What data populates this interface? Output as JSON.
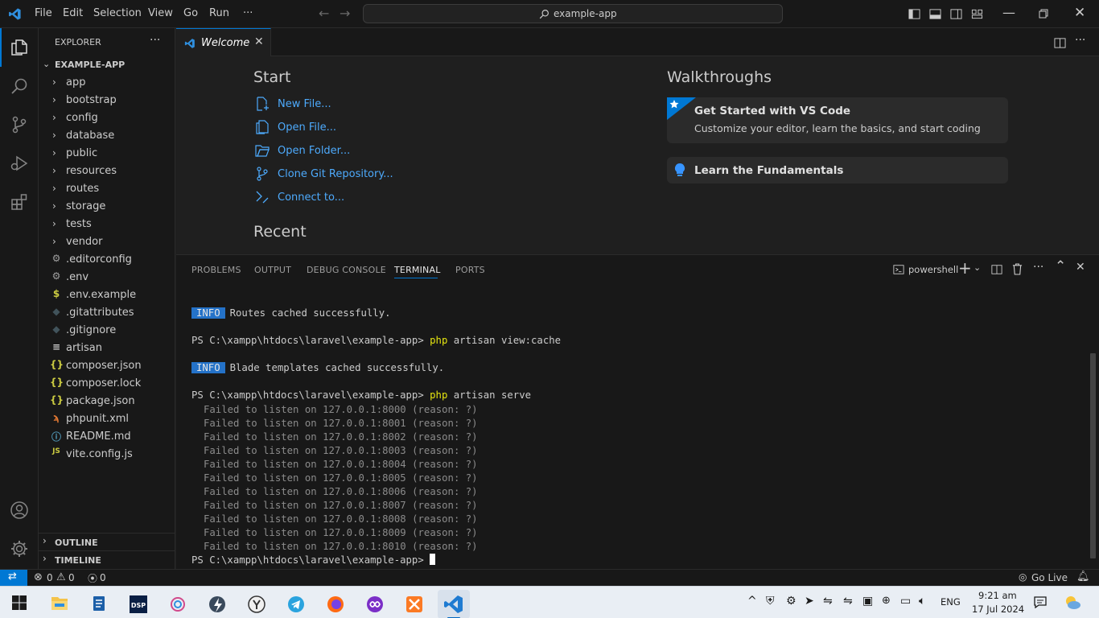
{
  "titlebar": {
    "menu": [
      "File",
      "Edit",
      "Selection",
      "View",
      "Go",
      "Run",
      "···"
    ],
    "search": "example-app"
  },
  "sidebar": {
    "title": "EXPLORER",
    "more": "···",
    "project": "EXAMPLE-APP",
    "folders": [
      "app",
      "bootstrap",
      "config",
      "database",
      "public",
      "resources",
      "routes",
      "storage",
      "tests",
      "vendor"
    ],
    "files": [
      {
        "name": ".editorconfig",
        "icon": "gear-icon",
        "glyph": "⚙",
        "color": "#a0a0a0"
      },
      {
        "name": ".env",
        "icon": "gear-icon",
        "glyph": "⚙",
        "color": "#a0a0a0"
      },
      {
        "name": ".env.example",
        "icon": "dollar-icon",
        "glyph": "$",
        "color": "#cbcb41"
      },
      {
        "name": ".gitattributes",
        "icon": "git-diamond-icon",
        "glyph": "◆",
        "color": "#41535b"
      },
      {
        "name": ".gitignore",
        "icon": "git-diamond-icon",
        "glyph": "◆",
        "color": "#41535b"
      },
      {
        "name": "artisan",
        "icon": "lines-icon",
        "glyph": "≡",
        "color": "#cccccc"
      },
      {
        "name": "composer.json",
        "icon": "braces-icon",
        "glyph": "{}",
        "color": "#cbcb41"
      },
      {
        "name": "composer.lock",
        "icon": "braces-icon",
        "glyph": "{}",
        "color": "#cbcb41"
      },
      {
        "name": "package.json",
        "icon": "braces-icon",
        "glyph": "{}",
        "color": "#cbcb41"
      },
      {
        "name": "phpunit.xml",
        "icon": "rss-icon",
        "glyph": "ϡ",
        "color": "#e37933"
      },
      {
        "name": "README.md",
        "icon": "info-icon",
        "glyph": "ⓘ",
        "color": "#519aba"
      },
      {
        "name": "vite.config.js",
        "icon": "js-icon",
        "glyph": "JS",
        "color": "#cbcb41"
      }
    ],
    "outline": "OUTLINE",
    "timeline": "TIMELINE"
  },
  "editor": {
    "tab": "Welcome",
    "start": {
      "heading": "Start",
      "links": [
        "New File...",
        "Open File...",
        "Open Folder...",
        "Clone Git Repository...",
        "Connect to..."
      ]
    },
    "recent": {
      "heading": "Recent"
    },
    "walkthroughs": {
      "heading": "Walkthroughs",
      "card1_title": "Get Started with VS Code",
      "card1_desc": "Customize your editor, learn the basics, and start coding",
      "card2_title": "Learn the Fundamentals"
    }
  },
  "panel": {
    "tabs": [
      "PROBLEMS",
      "OUTPUT",
      "DEBUG CONSOLE",
      "TERMINAL",
      "PORTS"
    ],
    "active_tab": "TERMINAL",
    "shell": "powershell",
    "terminal": {
      "info_label": "INFO",
      "routes_msg": "Routes cached successfully.",
      "prompt": "PS C:\\xampp\\htdocs\\laravel\\example-app>",
      "php": "php",
      "cmd_view": "artisan view:cache",
      "blade_msg": "Blade templates cached successfully.",
      "cmd_serve": "artisan serve",
      "failed": [
        "Failed to listen on 127.0.0.1:8000 (reason: ?)",
        "Failed to listen on 127.0.0.1:8001 (reason: ?)",
        "Failed to listen on 127.0.0.1:8002 (reason: ?)",
        "Failed to listen on 127.0.0.1:8003 (reason: ?)",
        "Failed to listen on 127.0.0.1:8004 (reason: ?)",
        "Failed to listen on 127.0.0.1:8005 (reason: ?)",
        "Failed to listen on 127.0.0.1:8006 (reason: ?)",
        "Failed to listen on 127.0.0.1:8007 (reason: ?)",
        "Failed to listen on 127.0.0.1:8008 (reason: ?)",
        "Failed to listen on 127.0.0.1:8009 (reason: ?)",
        "Failed to listen on 127.0.0.1:8010 (reason: ?)"
      ]
    }
  },
  "statusbar": {
    "errors": "0",
    "warnings": "0",
    "ports": "0",
    "golive": "Go Live"
  },
  "taskbar": {
    "lang": "ENG",
    "time": "9:21 am",
    "date": "17 Jul 2024"
  },
  "colors": {
    "accent": "#0078d4",
    "link": "#4daafc",
    "info_badge": "#2472c8"
  }
}
